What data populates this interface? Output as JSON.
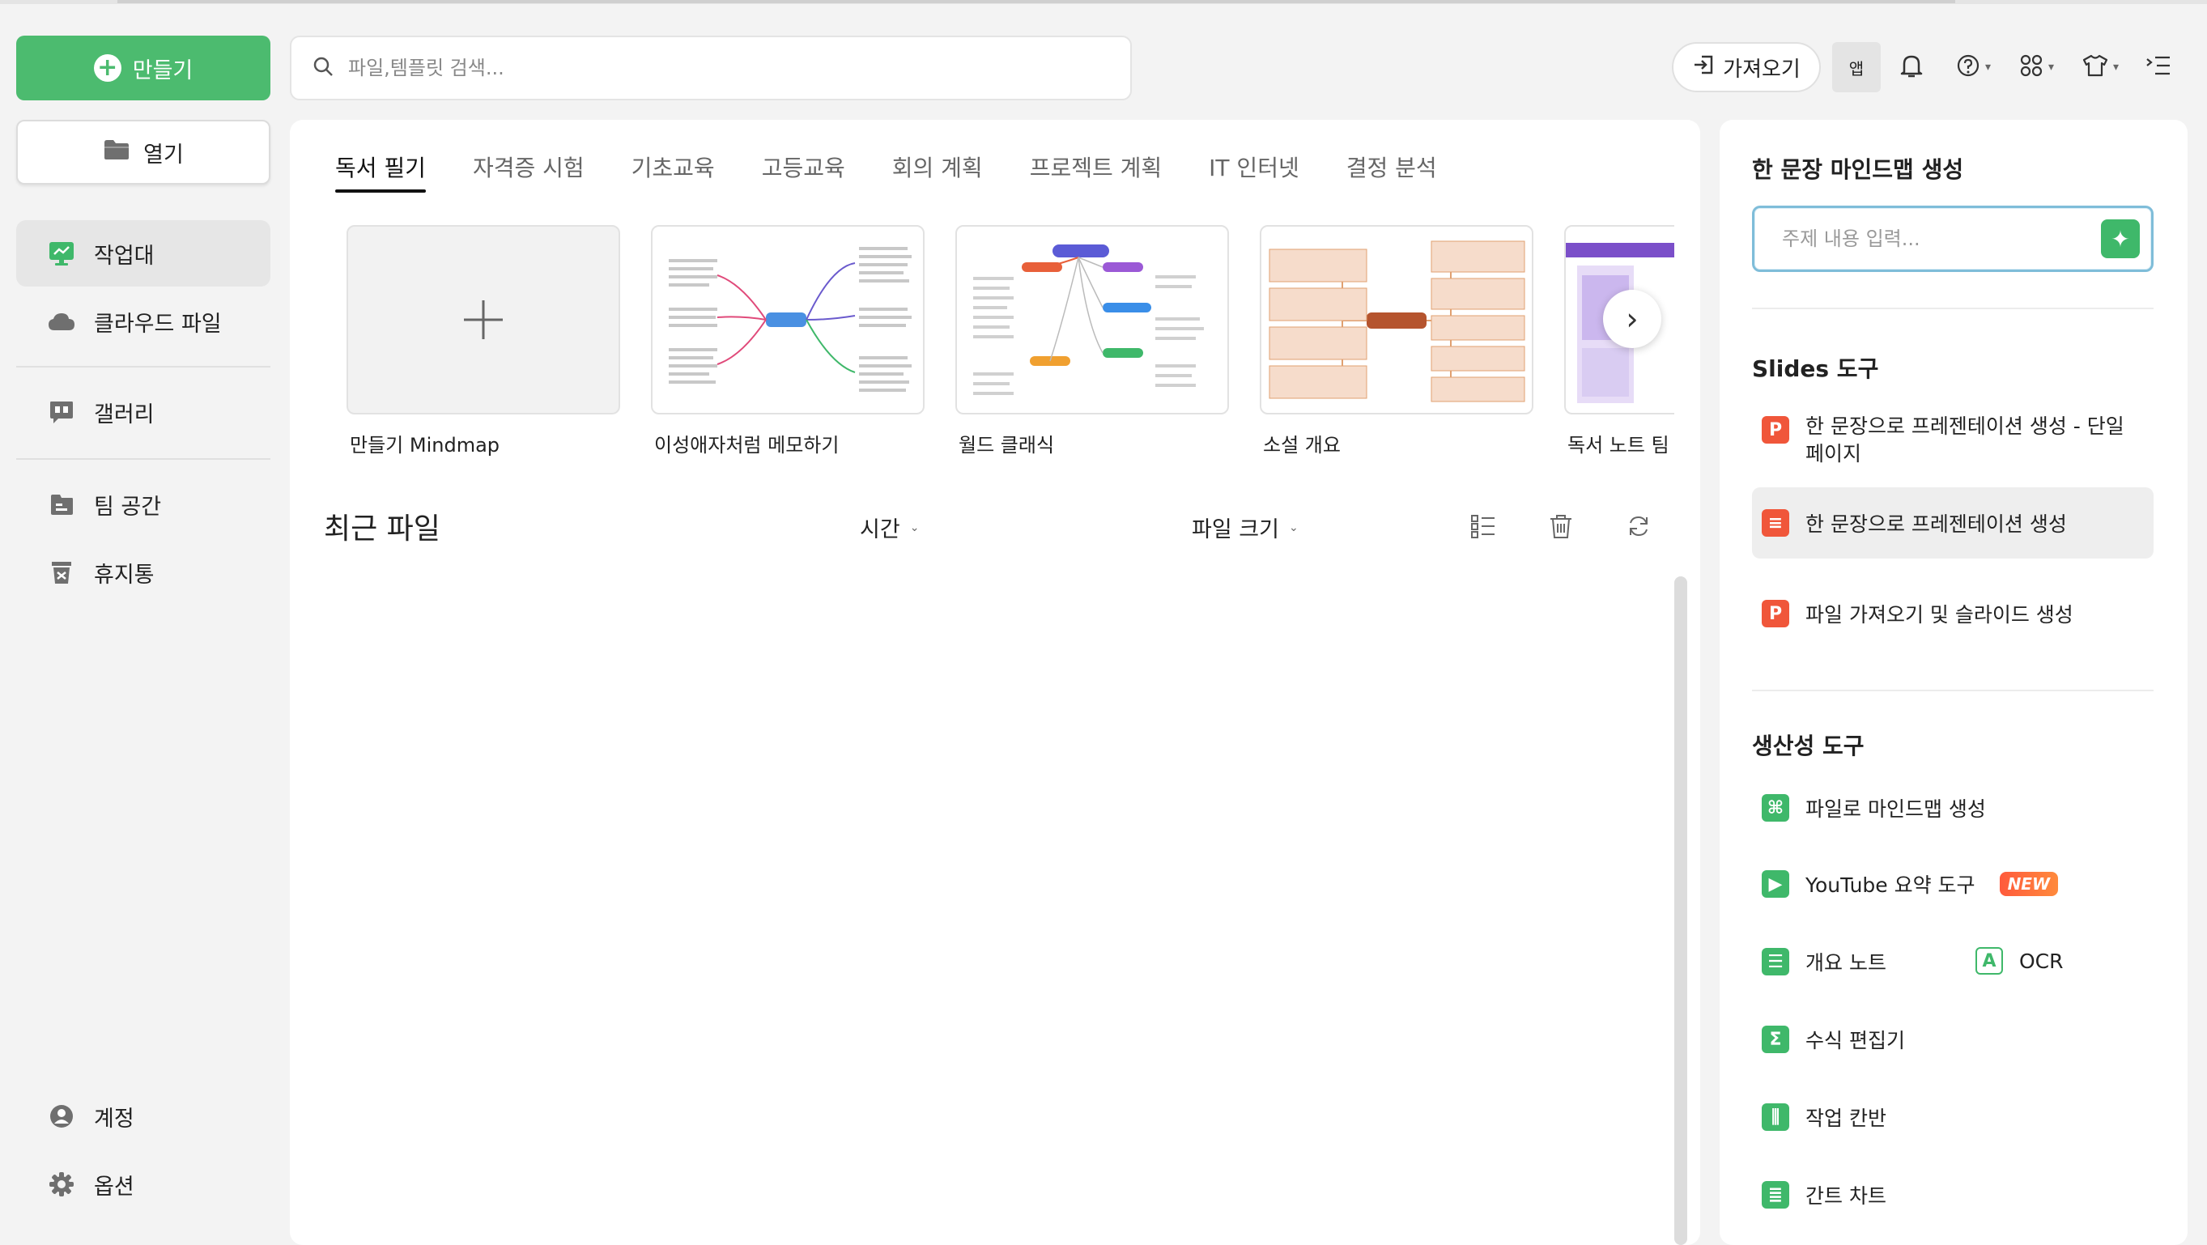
{
  "sidebar": {
    "create_label": "만들기",
    "open_label": "열기",
    "items": [
      {
        "label": "작업대"
      },
      {
        "label": "클라우드 파일"
      },
      {
        "label": "갤러리"
      },
      {
        "label": "팀 공간"
      },
      {
        "label": "휴지통"
      }
    ],
    "bottom": [
      {
        "label": "계정"
      },
      {
        "label": "옵션"
      }
    ]
  },
  "search": {
    "placeholder": "파일,템플릿 검색..."
  },
  "toolbar": {
    "import_label": "가져오기",
    "app_label": "앱"
  },
  "tabs": [
    "독서 필기",
    "자격증 시험",
    "기초교육",
    "고등교육",
    "회의 계획",
    "프로젝트 계획",
    "IT 인터넷",
    "결정 분석"
  ],
  "templates": [
    {
      "name": "만들기 Mindmap"
    },
    {
      "name": "이성애자처럼 메모하기"
    },
    {
      "name": "월드 클래식"
    },
    {
      "name": "소설 개요"
    },
    {
      "name": "독서 노트 팀"
    }
  ],
  "recent": {
    "title": "최근 파일",
    "sort_time": "시간",
    "sort_size": "파일 크기"
  },
  "right": {
    "ai_title": "한 문장 마인드맵 생성",
    "ai_placeholder": "주제 내용 입력...",
    "slides_title": "Slides 도구",
    "slides_tools": [
      {
        "label": "한 문장으로 프레젠테이션 생성 - 단일 페이지"
      },
      {
        "label": "한 문장으로 프레젠테이션 생성"
      },
      {
        "label": "파일 가져오기 및 슬라이드 생성"
      }
    ],
    "prod_title": "생산성 도구",
    "prod_tools": [
      {
        "label": "파일로 마인드맵 생성"
      },
      {
        "label": "YouTube 요약 도구",
        "badge": "NEW"
      },
      {
        "label": "개요 노트"
      },
      {
        "label": "OCR"
      },
      {
        "label": "수식 편집기"
      },
      {
        "label": "작업 칸반"
      },
      {
        "label": "간트 차트"
      }
    ]
  },
  "colors": {
    "accent": "#4cbb6f",
    "slides_red": "#f0563a",
    "badge": "#ff6a3c"
  }
}
